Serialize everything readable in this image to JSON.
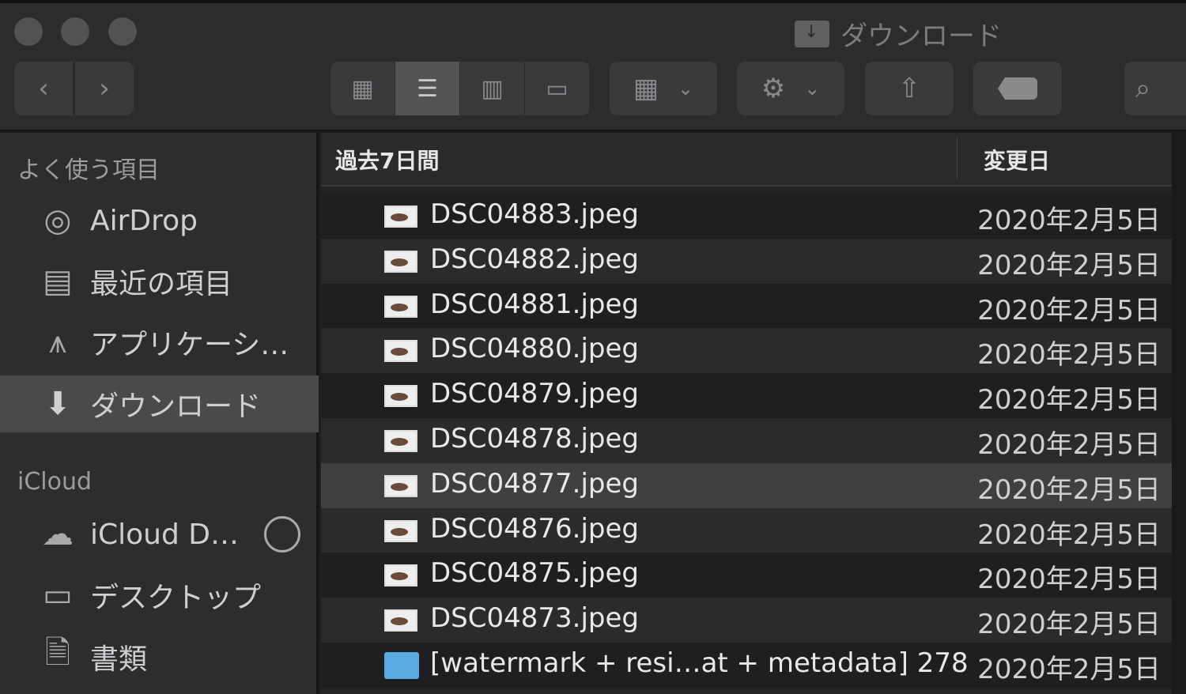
{
  "window": {
    "title": "ダウンロード"
  },
  "toolbar": {
    "back": "‹",
    "forward": "›",
    "views": [
      "icon-view",
      "list-view",
      "column-view",
      "gallery-view"
    ],
    "active_view": "list-view",
    "group": "group-by",
    "action": "action",
    "share": "share",
    "tag": "tag",
    "search": "search"
  },
  "sidebar": {
    "favorites_label": "よく使う項目",
    "favorites": [
      {
        "label": "AirDrop",
        "icon": "airdrop-icon"
      },
      {
        "label": "最近の項目",
        "icon": "recents-icon"
      },
      {
        "label": "アプリケーシ…",
        "icon": "applications-icon"
      },
      {
        "label": "ダウンロード",
        "icon": "downloads-icon",
        "selected": true
      }
    ],
    "icloud_label": "iCloud",
    "icloud": [
      {
        "label": "iCloud D…",
        "icon": "cloud-icon"
      },
      {
        "label": "デスクトップ",
        "icon": "desktop-icon"
      },
      {
        "label": "書類",
        "icon": "documents-icon"
      }
    ]
  },
  "list": {
    "group_header": "過去7日間",
    "date_header": "変更日",
    "rows": [
      {
        "name": "DSC04883.jpeg",
        "date": "2020年2月5日",
        "type": "image"
      },
      {
        "name": "DSC04882.jpeg",
        "date": "2020年2月5日",
        "type": "image"
      },
      {
        "name": "DSC04881.jpeg",
        "date": "2020年2月5日",
        "type": "image"
      },
      {
        "name": "DSC04880.jpeg",
        "date": "2020年2月5日",
        "type": "image"
      },
      {
        "name": "DSC04879.jpeg",
        "date": "2020年2月5日",
        "type": "image"
      },
      {
        "name": "DSC04878.jpeg",
        "date": "2020年2月5日",
        "type": "image"
      },
      {
        "name": "DSC04877.jpeg",
        "date": "2020年2月5日",
        "type": "image",
        "highlighted": true
      },
      {
        "name": "DSC04876.jpeg",
        "date": "2020年2月5日",
        "type": "image"
      },
      {
        "name": "DSC04875.jpeg",
        "date": "2020年2月5日",
        "type": "image"
      },
      {
        "name": "DSC04873.jpeg",
        "date": "2020年2月5日",
        "type": "image"
      },
      {
        "name": "[watermark + resi…at + metadata] 278",
        "date": "2020年2月5日",
        "type": "folder"
      }
    ]
  }
}
